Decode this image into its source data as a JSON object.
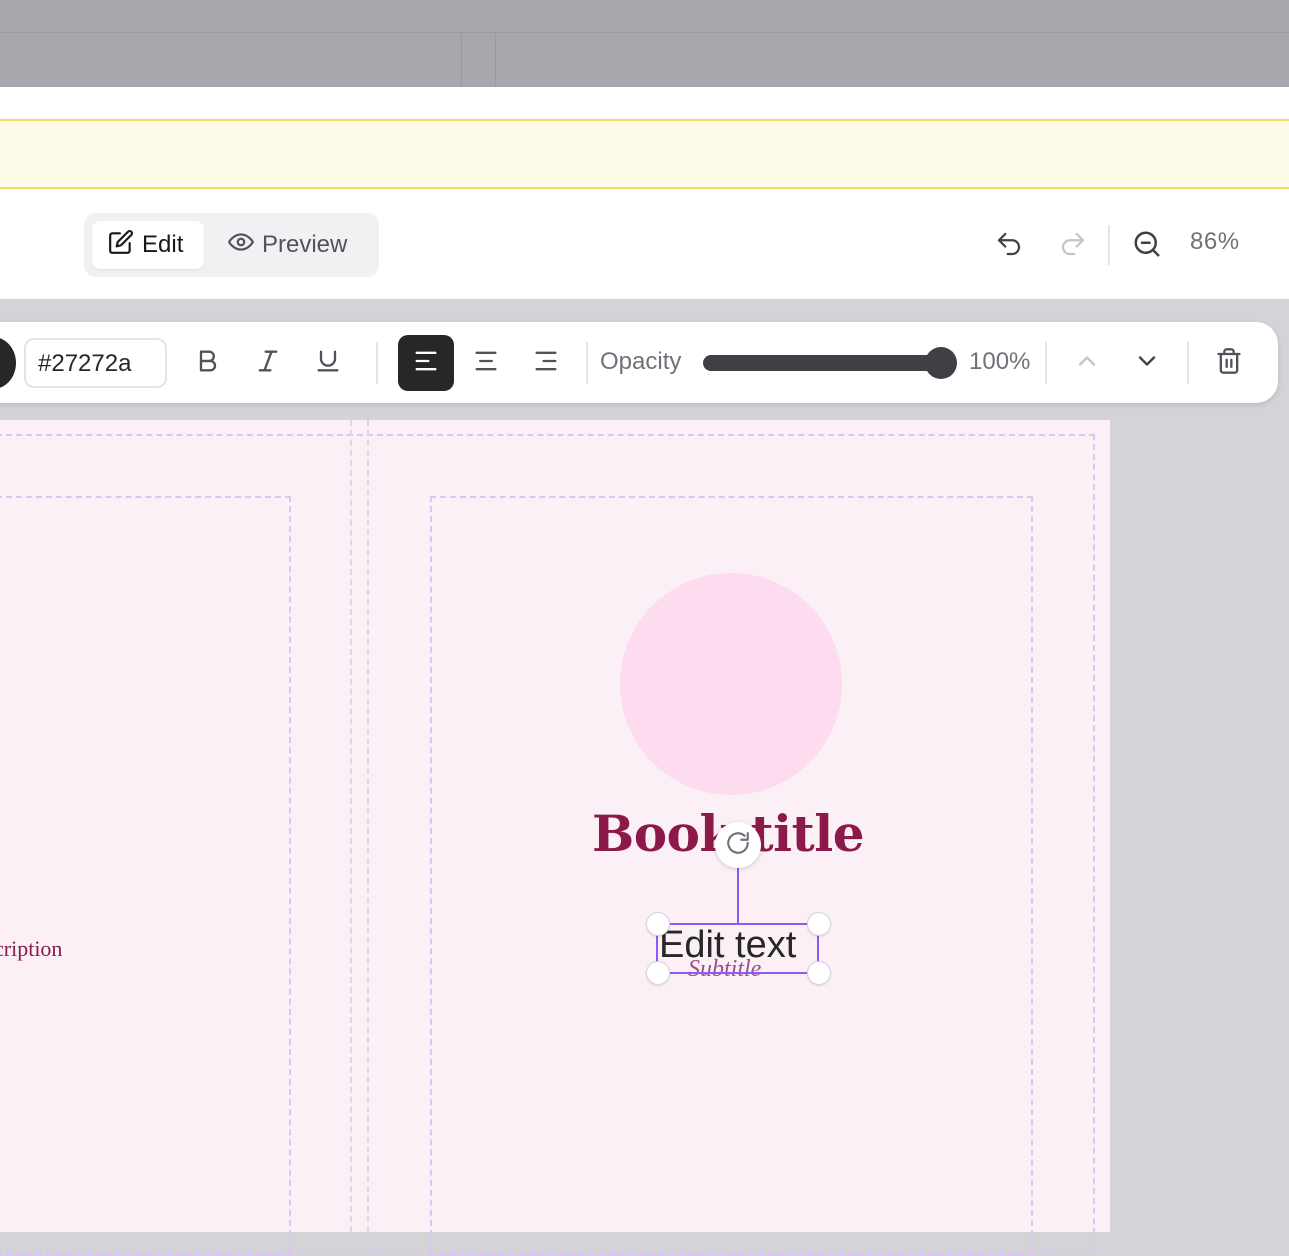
{
  "mode_toggle": {
    "edit_label": "Edit",
    "preview_label": "Preview",
    "active": "Edit"
  },
  "history": {
    "undo_icon": "undo-icon",
    "redo_icon": "redo-icon",
    "redo_enabled": false
  },
  "zoom": {
    "level_text": "86%",
    "zoom_out_icon": "zoom-out-icon"
  },
  "format_toolbar": {
    "color_hex": "#27272a",
    "bold_icon": "bold-icon",
    "italic_icon": "italic-icon",
    "underline_icon": "underline-icon",
    "align_options": [
      "left",
      "center",
      "right"
    ],
    "align_active": "left",
    "opacity_label": "Opacity",
    "opacity_value": 1.0,
    "opacity_text": "100%",
    "move_up_icon": "chevron-up-icon",
    "move_down_icon": "chevron-down-icon",
    "delete_icon": "trash-icon"
  },
  "canvas": {
    "left_page_text": "cription",
    "book_title": "Book title",
    "subtitle": "Subtitle",
    "selected_text": "Edit text",
    "rotate_icon": "rotate-icon"
  },
  "colors": {
    "accent_selection": "#8b5cf6",
    "title_color": "#8b1a4a",
    "canvas_bg": "#fcf0f7",
    "notice_bg": "#fefbe8"
  }
}
